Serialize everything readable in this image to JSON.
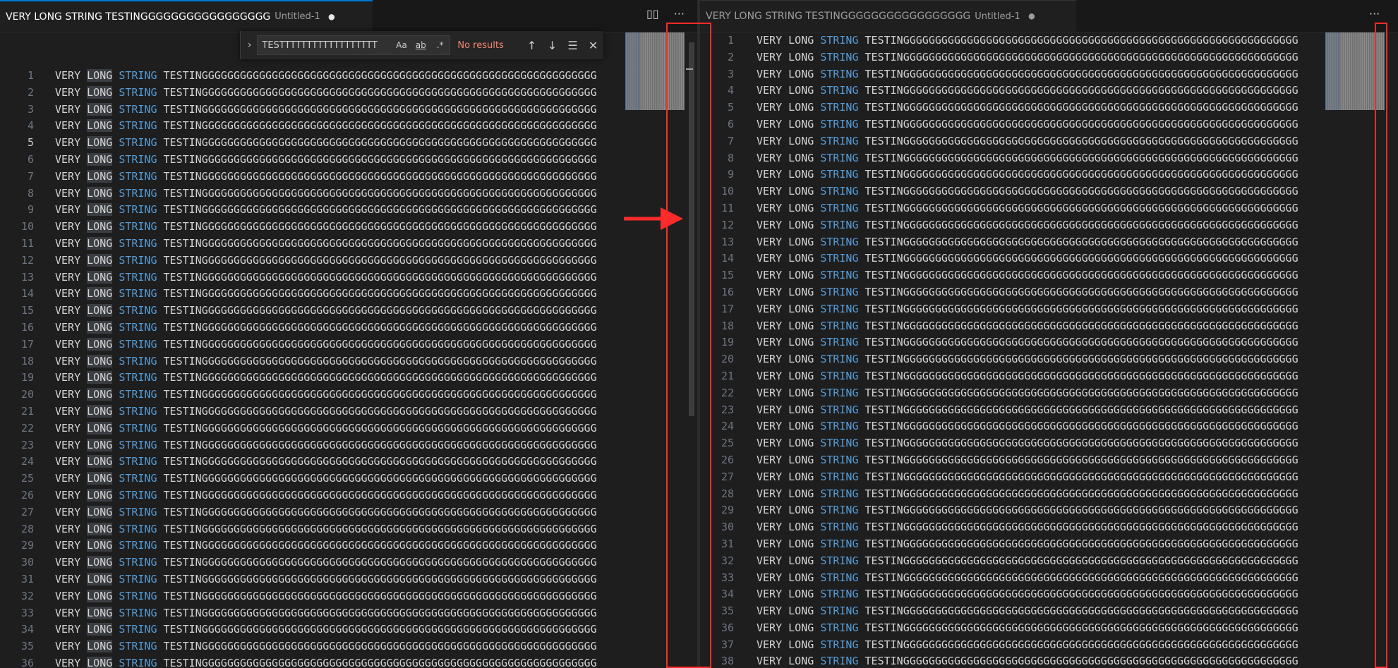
{
  "tab": {
    "title": "VERY LONG STRING TESTINGGGGGGGGGGGGGGGGG",
    "description": "Untitled-1",
    "dirty_indicator": "●"
  },
  "left_actions": {
    "split": "▯▯",
    "more": "···"
  },
  "right_actions": {
    "more": "···"
  },
  "find_widget": {
    "toggle": "›",
    "value": "TESTTTTTTTTTTTTTTTTTT",
    "match_case": "Aa",
    "whole_word": "ab",
    "regex": ".*",
    "status": "No results",
    "prev": "↑",
    "next": "↓",
    "in_selection": "☰",
    "close": "✕"
  },
  "code_line": {
    "w1": "VERY ",
    "w2": "LONG",
    "sp": " ",
    "w3": "STRING",
    "w4": " TESTINGGGGGGGGGGGGGGGGGGGGGGGGGGGGGGGGGGGGGGGGGGGGGGGGGGGGGGGGGGGGGG"
  },
  "left_lines": [
    "1",
    "2",
    "3",
    "4",
    "5",
    "6",
    "7",
    "8",
    "9",
    "10",
    "11",
    "12",
    "13",
    "14",
    "15",
    "16",
    "17",
    "18",
    "19",
    "20",
    "21",
    "22",
    "23",
    "24",
    "25",
    "26",
    "27",
    "28",
    "29",
    "30",
    "31",
    "32",
    "33",
    "34",
    "35",
    "36"
  ],
  "right_lines": [
    "1",
    "2",
    "3",
    "4",
    "5",
    "6",
    "7",
    "8",
    "9",
    "10",
    "11",
    "12",
    "13",
    "14",
    "15",
    "16",
    "17",
    "18",
    "19",
    "20",
    "21",
    "22",
    "23",
    "24",
    "25",
    "26",
    "27",
    "28",
    "29",
    "30",
    "31",
    "32",
    "33",
    "34",
    "35",
    "36",
    "37",
    "38"
  ],
  "left_active_line": "5",
  "colors": {
    "keyword": "#569cd6",
    "annotation": "#ff2b2b",
    "status_error": "#f48771"
  }
}
